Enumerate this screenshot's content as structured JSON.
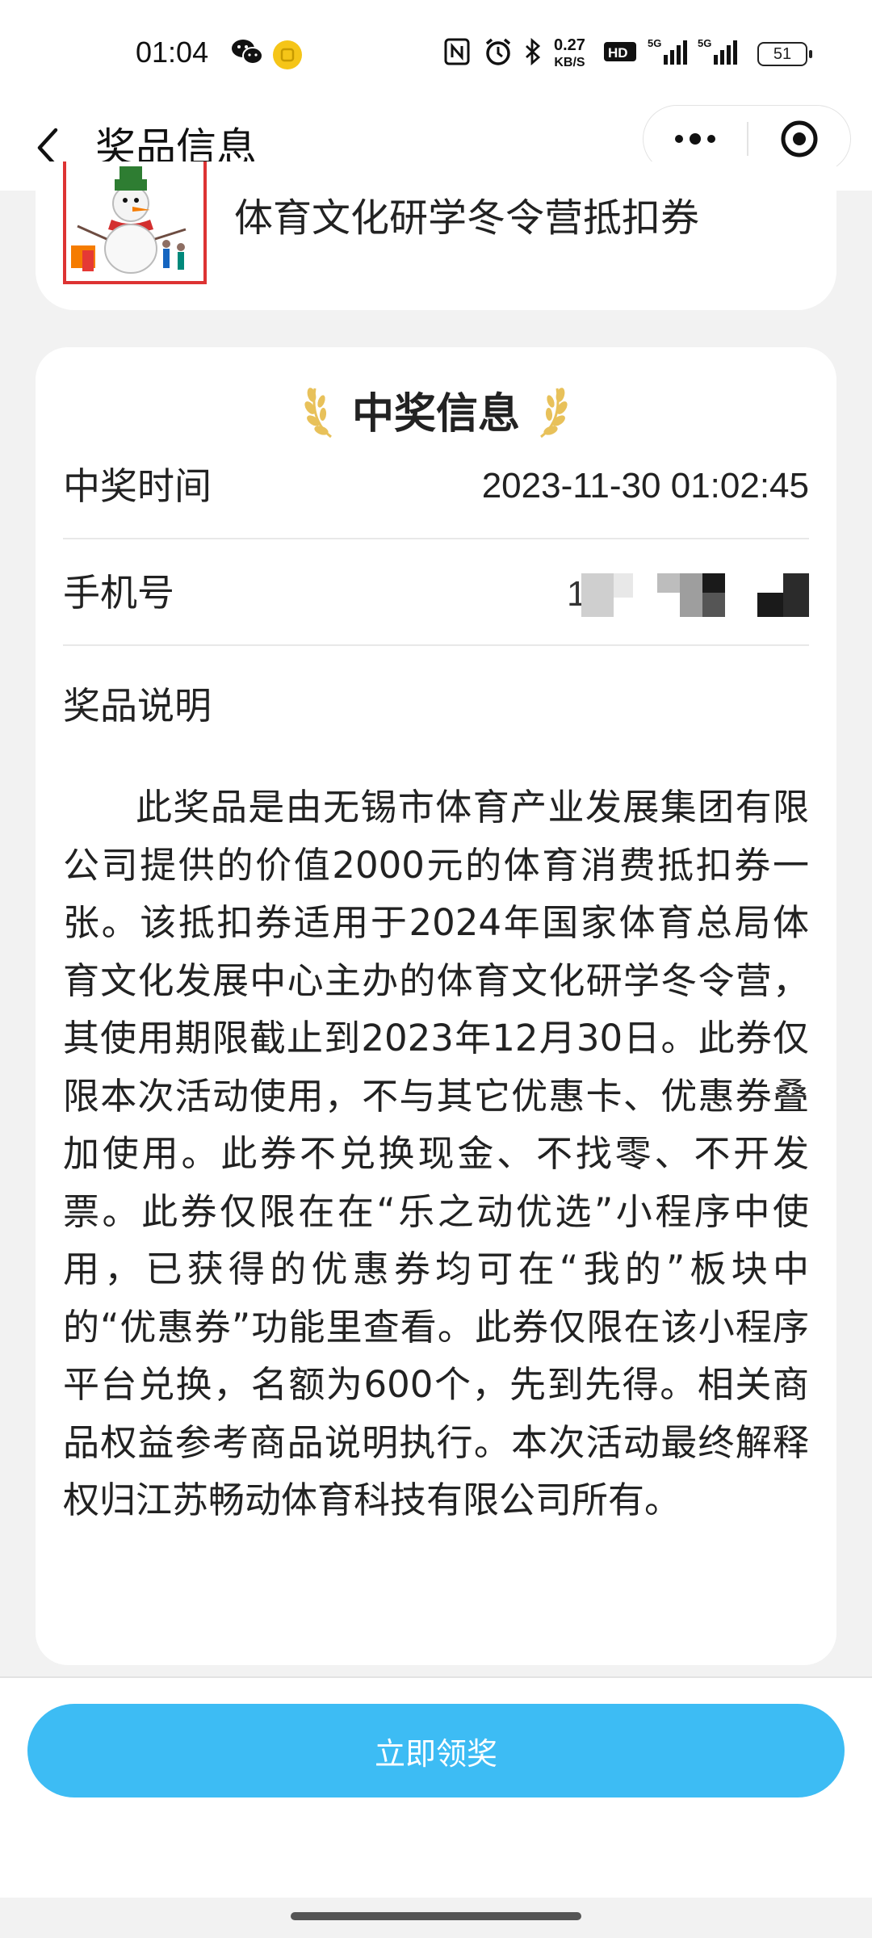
{
  "status_bar": {
    "time": "01:04",
    "speed_top": "0.27",
    "speed_bottom": "KB/S",
    "battery": "51",
    "icons": [
      "wechat-icon",
      "mini-program-icon",
      "nfc-icon",
      "alarm-icon",
      "bluetooth-icon",
      "hd-icon",
      "signal-5g-icon",
      "signal-5g-icon"
    ]
  },
  "nav": {
    "title": "奖品信息"
  },
  "prize": {
    "name": "体育文化研学冬令营抵扣券"
  },
  "info": {
    "heading": "中奖信息",
    "time_label": "中奖时间",
    "time_value": "2023-11-30 01:02:45",
    "phone_label": "手机号",
    "desc_label": "奖品说明",
    "desc_text": "此奖品是由无锡市体育产业发展集团有限公司提供的价值2000元的体育消费抵扣券一张。该抵扣券适用于2024年国家体育总局体育文化发展中心主办的体育文化研学冬令营，其使用期限截止到2023年12月30日。此券仅限本次活动使用，不与其它优惠卡、优惠券叠加使用。此券不兑换现金、不找零、不开发票。此券仅限在在“乐之动优选”小程序中使用，已获得的优惠券均可在“我的”板块中的“优惠券”功能里查看。此券仅限在该小程序平台兑换，名额为600个，先到先得。相关商品权益参考商品说明执行。本次活动最终解释权归江苏畅动体育科技有限公司所有。"
  },
  "actions": {
    "claim_label": "立即领奖"
  },
  "colors": {
    "primary": "#3dbcf4",
    "laurel": "#e8c15a",
    "page_bg": "#f2f2f2"
  }
}
